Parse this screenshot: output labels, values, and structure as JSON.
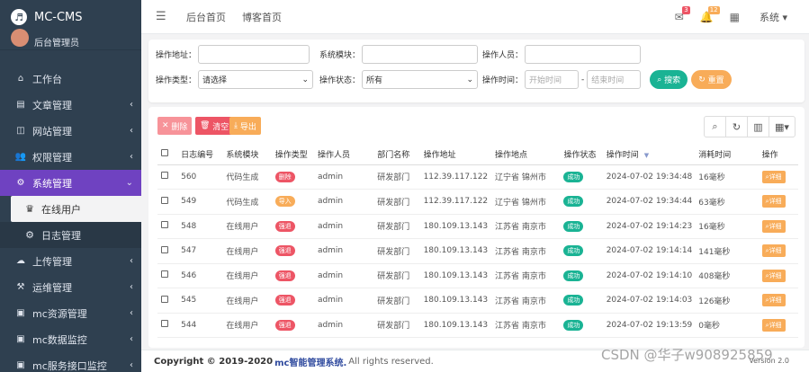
{
  "brand": {
    "name": "MC-CMS",
    "user": "后台管理员"
  },
  "sidebar": {
    "items": [
      {
        "label": "工作台",
        "icon": "home-icon",
        "chev": ""
      },
      {
        "label": "文章管理",
        "icon": "article-icon",
        "chev": "‹"
      },
      {
        "label": "网站管理",
        "icon": "site-icon",
        "chev": "‹"
      },
      {
        "label": "权限管理",
        "icon": "users-icon",
        "chev": "‹"
      },
      {
        "label": "系统管理",
        "icon": "gear-icon",
        "chev": "⌄"
      },
      {
        "label": "上传管理",
        "icon": "upload-icon",
        "chev": "‹"
      },
      {
        "label": "运维管理",
        "icon": "ops-icon",
        "chev": "‹"
      },
      {
        "label": "mc资源管理",
        "icon": "resource-icon",
        "chev": "‹"
      },
      {
        "label": "mc数据监控",
        "icon": "monitor-icon",
        "chev": "‹"
      },
      {
        "label": "mc服务接口监控",
        "icon": "api-icon",
        "chev": "‹"
      }
    ],
    "sub": [
      {
        "label": "在线用户"
      },
      {
        "label": "日志管理"
      }
    ]
  },
  "topbar": {
    "tabs": [
      "后台首页",
      "博客首页"
    ],
    "badge_msg": "3",
    "badge_bell": "12",
    "system": "系统 ▾"
  },
  "search": {
    "addr_label": "操作地址：",
    "module_label": "系统模块：",
    "operator_label": "操作人员：",
    "type_label": "操作类型：",
    "type_value": "请选择",
    "status_label": "操作状态：",
    "status_value": "所有",
    "time_label": "操作时间：",
    "start_ph": "开始时间",
    "end_ph": "结束时间",
    "dash": "-",
    "search_btn": "搜索",
    "reset_btn": "重置"
  },
  "toolbar": {
    "delete": "删除",
    "clear": "清空",
    "export": "导出"
  },
  "table": {
    "headers": [
      "日志编号",
      "系统模块",
      "操作类型",
      "操作人员",
      "部门名称",
      "操作地址",
      "操作地点",
      "操作状态",
      "操作时间",
      "消耗时间",
      "操作"
    ],
    "detail": "详细",
    "rows": [
      {
        "id": "560",
        "module": "代码生成",
        "type": "删除",
        "typeColor": "red",
        "user": "admin",
        "dept": "研发部门",
        "ip": "112.39.117.122",
        "loc": "辽宁省 锦州市",
        "status": "成功",
        "time": "2024-07-02 19:34:48",
        "cost": "16毫秒"
      },
      {
        "id": "549",
        "module": "代码生成",
        "type": "导入",
        "typeColor": "orange",
        "user": "admin",
        "dept": "研发部门",
        "ip": "112.39.117.122",
        "loc": "辽宁省 锦州市",
        "status": "成功",
        "time": "2024-07-02 19:34:44",
        "cost": "63毫秒"
      },
      {
        "id": "548",
        "module": "在线用户",
        "type": "强退",
        "typeColor": "red",
        "user": "admin",
        "dept": "研发部门",
        "ip": "180.109.13.143",
        "loc": "江苏省 南京市",
        "status": "成功",
        "time": "2024-07-02 19:14:23",
        "cost": "16毫秒"
      },
      {
        "id": "547",
        "module": "在线用户",
        "type": "强退",
        "typeColor": "red",
        "user": "admin",
        "dept": "研发部门",
        "ip": "180.109.13.143",
        "loc": "江苏省 南京市",
        "status": "成功",
        "time": "2024-07-02 19:14:14",
        "cost": "141毫秒"
      },
      {
        "id": "546",
        "module": "在线用户",
        "type": "强退",
        "typeColor": "red",
        "user": "admin",
        "dept": "研发部门",
        "ip": "180.109.13.143",
        "loc": "江苏省 南京市",
        "status": "成功",
        "time": "2024-07-02 19:14:10",
        "cost": "408毫秒"
      },
      {
        "id": "545",
        "module": "在线用户",
        "type": "强退",
        "typeColor": "red",
        "user": "admin",
        "dept": "研发部门",
        "ip": "180.109.13.143",
        "loc": "江苏省 南京市",
        "status": "成功",
        "time": "2024-07-02 19:14:03",
        "cost": "126毫秒"
      },
      {
        "id": "544",
        "module": "在线用户",
        "type": "强退",
        "typeColor": "red",
        "user": "admin",
        "dept": "研发部门",
        "ip": "180.109.13.143",
        "loc": "江苏省 南京市",
        "status": "成功",
        "time": "2024-07-02 19:13:59",
        "cost": "0毫秒"
      }
    ]
  },
  "footer": {
    "copyright": "Copyright © 2019-2020",
    "brand": "mc智能管理系统.",
    "rights": "All rights reserved.",
    "version": "Version 2.0"
  },
  "watermark": "CSDN @华子w908925859",
  "colors": {
    "sidebar": "#2f4050",
    "active": "#6f42c1",
    "success": "#1ab394",
    "warning": "#f8ac59",
    "danger": "#ed5565"
  }
}
